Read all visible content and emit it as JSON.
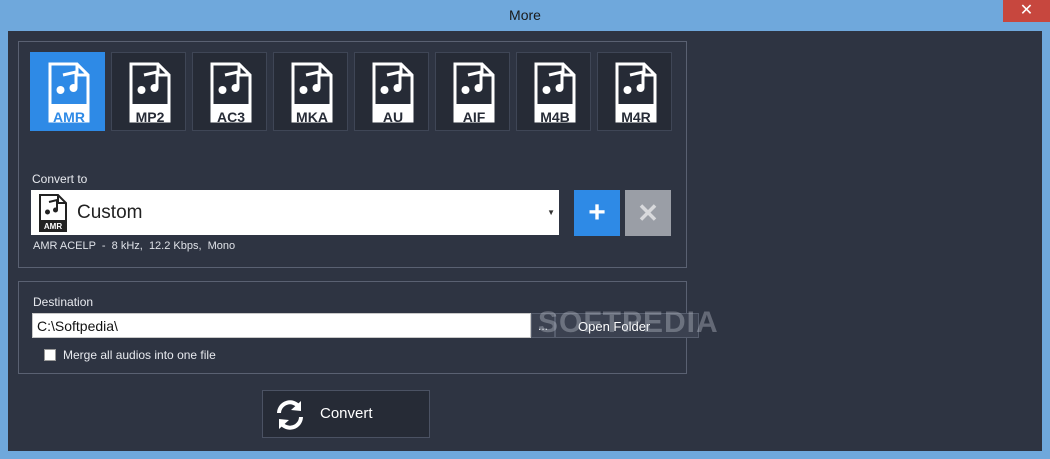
{
  "window": {
    "title": "More",
    "close_glyph": "✕"
  },
  "formats": {
    "selected": "AMR",
    "items": [
      {
        "label": "AMR"
      },
      {
        "label": "MP2"
      },
      {
        "label": "AC3"
      },
      {
        "label": "MKA"
      },
      {
        "label": "AU"
      },
      {
        "label": "AIF"
      },
      {
        "label": "M4B"
      },
      {
        "label": "M4R"
      }
    ]
  },
  "convert_to": {
    "label": "Convert to",
    "value": "Custom",
    "icon_label": "AMR",
    "info": "AMR ACELP  -  8 kHz,  12.2 Kbps,  Mono",
    "add_glyph": "+",
    "remove_glyph": "✕",
    "arrow_glyph": "▼"
  },
  "destination": {
    "label": "Destination",
    "path": "C:\\Softpedia\\",
    "browse_label": "...",
    "open_folder_label": "Open Folder",
    "merge_label": "Merge all audios into one file",
    "merge_checked": false
  },
  "watermark": "SOFTPEDIA",
  "convert_button": {
    "label": "Convert"
  },
  "colors": {
    "accent": "#2e8ae6",
    "background": "#2e3442",
    "titlebar": "#6fa8dc"
  }
}
